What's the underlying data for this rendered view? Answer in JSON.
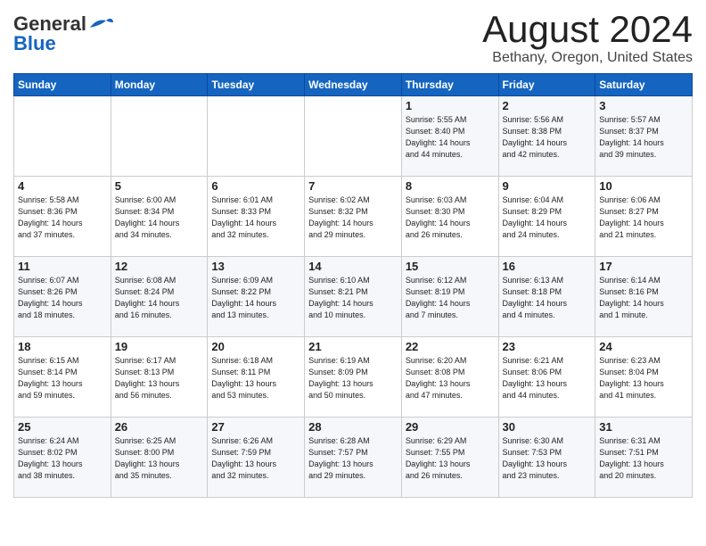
{
  "header": {
    "logo_general": "General",
    "logo_blue": "Blue",
    "month_title": "August 2024",
    "location": "Bethany, Oregon, United States"
  },
  "weekdays": [
    "Sunday",
    "Monday",
    "Tuesday",
    "Wednesday",
    "Thursday",
    "Friday",
    "Saturday"
  ],
  "weeks": [
    [
      {
        "day": "",
        "info": ""
      },
      {
        "day": "",
        "info": ""
      },
      {
        "day": "",
        "info": ""
      },
      {
        "day": "",
        "info": ""
      },
      {
        "day": "1",
        "info": "Sunrise: 5:55 AM\nSunset: 8:40 PM\nDaylight: 14 hours\nand 44 minutes."
      },
      {
        "day": "2",
        "info": "Sunrise: 5:56 AM\nSunset: 8:38 PM\nDaylight: 14 hours\nand 42 minutes."
      },
      {
        "day": "3",
        "info": "Sunrise: 5:57 AM\nSunset: 8:37 PM\nDaylight: 14 hours\nand 39 minutes."
      }
    ],
    [
      {
        "day": "4",
        "info": "Sunrise: 5:58 AM\nSunset: 8:36 PM\nDaylight: 14 hours\nand 37 minutes."
      },
      {
        "day": "5",
        "info": "Sunrise: 6:00 AM\nSunset: 8:34 PM\nDaylight: 14 hours\nand 34 minutes."
      },
      {
        "day": "6",
        "info": "Sunrise: 6:01 AM\nSunset: 8:33 PM\nDaylight: 14 hours\nand 32 minutes."
      },
      {
        "day": "7",
        "info": "Sunrise: 6:02 AM\nSunset: 8:32 PM\nDaylight: 14 hours\nand 29 minutes."
      },
      {
        "day": "8",
        "info": "Sunrise: 6:03 AM\nSunset: 8:30 PM\nDaylight: 14 hours\nand 26 minutes."
      },
      {
        "day": "9",
        "info": "Sunrise: 6:04 AM\nSunset: 8:29 PM\nDaylight: 14 hours\nand 24 minutes."
      },
      {
        "day": "10",
        "info": "Sunrise: 6:06 AM\nSunset: 8:27 PM\nDaylight: 14 hours\nand 21 minutes."
      }
    ],
    [
      {
        "day": "11",
        "info": "Sunrise: 6:07 AM\nSunset: 8:26 PM\nDaylight: 14 hours\nand 18 minutes."
      },
      {
        "day": "12",
        "info": "Sunrise: 6:08 AM\nSunset: 8:24 PM\nDaylight: 14 hours\nand 16 minutes."
      },
      {
        "day": "13",
        "info": "Sunrise: 6:09 AM\nSunset: 8:22 PM\nDaylight: 14 hours\nand 13 minutes."
      },
      {
        "day": "14",
        "info": "Sunrise: 6:10 AM\nSunset: 8:21 PM\nDaylight: 14 hours\nand 10 minutes."
      },
      {
        "day": "15",
        "info": "Sunrise: 6:12 AM\nSunset: 8:19 PM\nDaylight: 14 hours\nand 7 minutes."
      },
      {
        "day": "16",
        "info": "Sunrise: 6:13 AM\nSunset: 8:18 PM\nDaylight: 14 hours\nand 4 minutes."
      },
      {
        "day": "17",
        "info": "Sunrise: 6:14 AM\nSunset: 8:16 PM\nDaylight: 14 hours\nand 1 minute."
      }
    ],
    [
      {
        "day": "18",
        "info": "Sunrise: 6:15 AM\nSunset: 8:14 PM\nDaylight: 13 hours\nand 59 minutes."
      },
      {
        "day": "19",
        "info": "Sunrise: 6:17 AM\nSunset: 8:13 PM\nDaylight: 13 hours\nand 56 minutes."
      },
      {
        "day": "20",
        "info": "Sunrise: 6:18 AM\nSunset: 8:11 PM\nDaylight: 13 hours\nand 53 minutes."
      },
      {
        "day": "21",
        "info": "Sunrise: 6:19 AM\nSunset: 8:09 PM\nDaylight: 13 hours\nand 50 minutes."
      },
      {
        "day": "22",
        "info": "Sunrise: 6:20 AM\nSunset: 8:08 PM\nDaylight: 13 hours\nand 47 minutes."
      },
      {
        "day": "23",
        "info": "Sunrise: 6:21 AM\nSunset: 8:06 PM\nDaylight: 13 hours\nand 44 minutes."
      },
      {
        "day": "24",
        "info": "Sunrise: 6:23 AM\nSunset: 8:04 PM\nDaylight: 13 hours\nand 41 minutes."
      }
    ],
    [
      {
        "day": "25",
        "info": "Sunrise: 6:24 AM\nSunset: 8:02 PM\nDaylight: 13 hours\nand 38 minutes."
      },
      {
        "day": "26",
        "info": "Sunrise: 6:25 AM\nSunset: 8:00 PM\nDaylight: 13 hours\nand 35 minutes."
      },
      {
        "day": "27",
        "info": "Sunrise: 6:26 AM\nSunset: 7:59 PM\nDaylight: 13 hours\nand 32 minutes."
      },
      {
        "day": "28",
        "info": "Sunrise: 6:28 AM\nSunset: 7:57 PM\nDaylight: 13 hours\nand 29 minutes."
      },
      {
        "day": "29",
        "info": "Sunrise: 6:29 AM\nSunset: 7:55 PM\nDaylight: 13 hours\nand 26 minutes."
      },
      {
        "day": "30",
        "info": "Sunrise: 6:30 AM\nSunset: 7:53 PM\nDaylight: 13 hours\nand 23 minutes."
      },
      {
        "day": "31",
        "info": "Sunrise: 6:31 AM\nSunset: 7:51 PM\nDaylight: 13 hours\nand 20 minutes."
      }
    ]
  ]
}
